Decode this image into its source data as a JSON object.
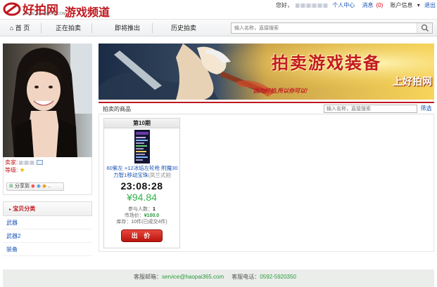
{
  "header": {
    "logo_name": "好拍网",
    "logo_domain": "GAME.HAOPAI365.COM",
    "channel": "游戏频道",
    "greeting": "您好，",
    "user_center": "个人中心",
    "messages_label": "消息",
    "messages_count": "(0)",
    "account_info": "账户信息",
    "logout": "退出"
  },
  "nav": {
    "items": [
      "首 页",
      "正在拍卖",
      "即将推出",
      "历史拍卖"
    ],
    "search_placeholder": "输入名称，直接搜索"
  },
  "seller": {
    "seller_label": "卖家:",
    "level_label": "等级:",
    "share_label": "分享到"
  },
  "categories": {
    "title": "宝贝分类",
    "items": [
      "武器",
      "武器2",
      "装备"
    ]
  },
  "banner": {
    "title": "拍卖游戏装备",
    "subtitle": "上好拍网",
    "slogan": "因为好拍,所以你可以!"
  },
  "products": {
    "section_title": "拍卖的商品",
    "search_placeholder": "输入名称，直接搜索",
    "filter_label": "筛选"
  },
  "card": {
    "issue": "第10期",
    "name": "60紫左 +12冰焰左轮枪 附魔30力智1移动宝珠",
    "name_sub": "(凤兰式拍",
    "countdown": "23:08:28",
    "price": "¥94.84",
    "bidders_label": "参与人数：",
    "bidders_value": "1",
    "market_label": "市场价：",
    "market_value": "¥100.0",
    "stock_text": "库存：10件(已成交4件)",
    "bid_label": "出 价"
  },
  "footer": {
    "email_label": "客服邮箱：",
    "email": "service@haopai365.com",
    "phone_label": "客服电话：",
    "phone": "0592-5920350"
  },
  "colors": {
    "brand_red": "#c0171e",
    "link_blue": "#1a55b5",
    "price_green": "#2db34a"
  }
}
